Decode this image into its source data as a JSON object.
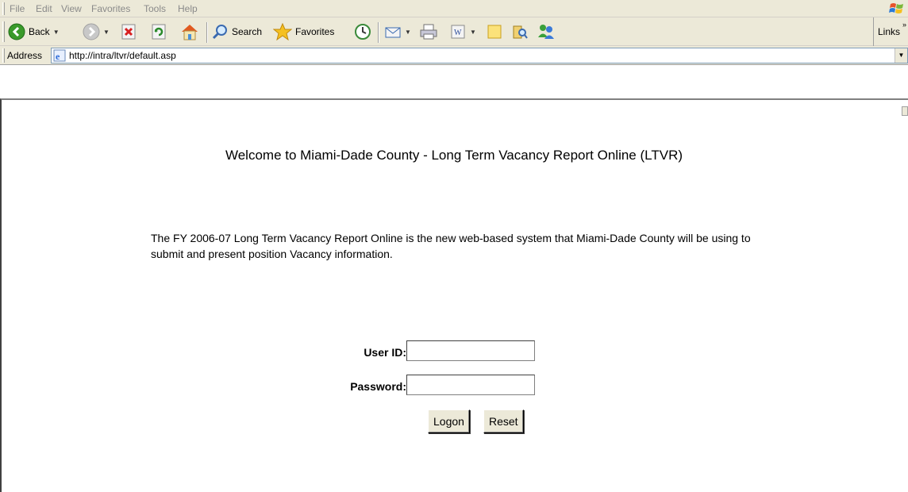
{
  "browser": {
    "menu": [
      "File",
      "Edit",
      "View",
      "Favorites",
      "Tools",
      "Help"
    ],
    "toolbar": {
      "back_label": "Back",
      "search_label": "Search",
      "favorites_label": "Favorites",
      "links_label": "Links"
    },
    "address": {
      "label": "Address",
      "url": "http://intra/ltvr/default.asp"
    }
  },
  "page": {
    "title": "Welcome to Miami-Dade County - Long Term Vacancy Report Online (LTVR)",
    "intro": "The FY 2006-07 Long Term Vacancy Report Online is the new web-based system that Miami-Dade County will be using to submit and present position Vacancy information."
  },
  "login": {
    "user_id_label": "User ID:",
    "user_id_value": "",
    "password_label": "Password:",
    "password_value": "",
    "logon_label": "Logon",
    "reset_label": "Reset"
  }
}
